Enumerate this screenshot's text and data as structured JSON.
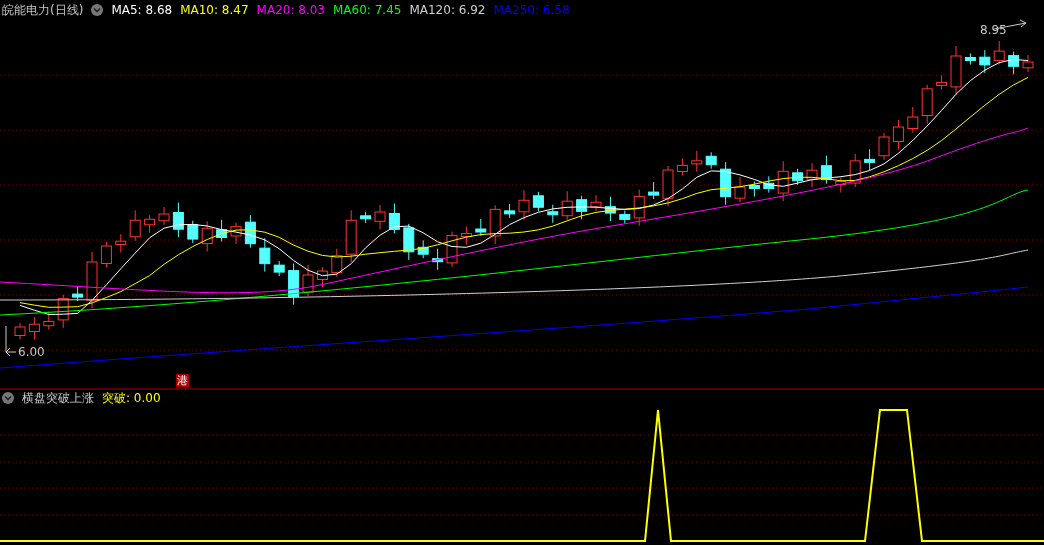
{
  "header": {
    "title": "皖能电力(日线)",
    "indicators": [
      {
        "label": "MA5: 8.68",
        "color": "#ffffff"
      },
      {
        "label": "MA10: 8.47",
        "color": "#ffff00"
      },
      {
        "label": "MA20: 8.03",
        "color": "#ff00ff"
      },
      {
        "label": "MA60: 7.45",
        "color": "#00ff00"
      },
      {
        "label": "MA120: 6.92",
        "color": "#d0d0d0"
      },
      {
        "label": "MA250: 6.58",
        "color": "#0000ff"
      }
    ]
  },
  "price_chart": {
    "max_label": "8.95",
    "min_label": "6.00",
    "marker": "港"
  },
  "indicator_panel": {
    "title": "横盘突破上涨",
    "value_text": "突破: 0.00"
  }
}
